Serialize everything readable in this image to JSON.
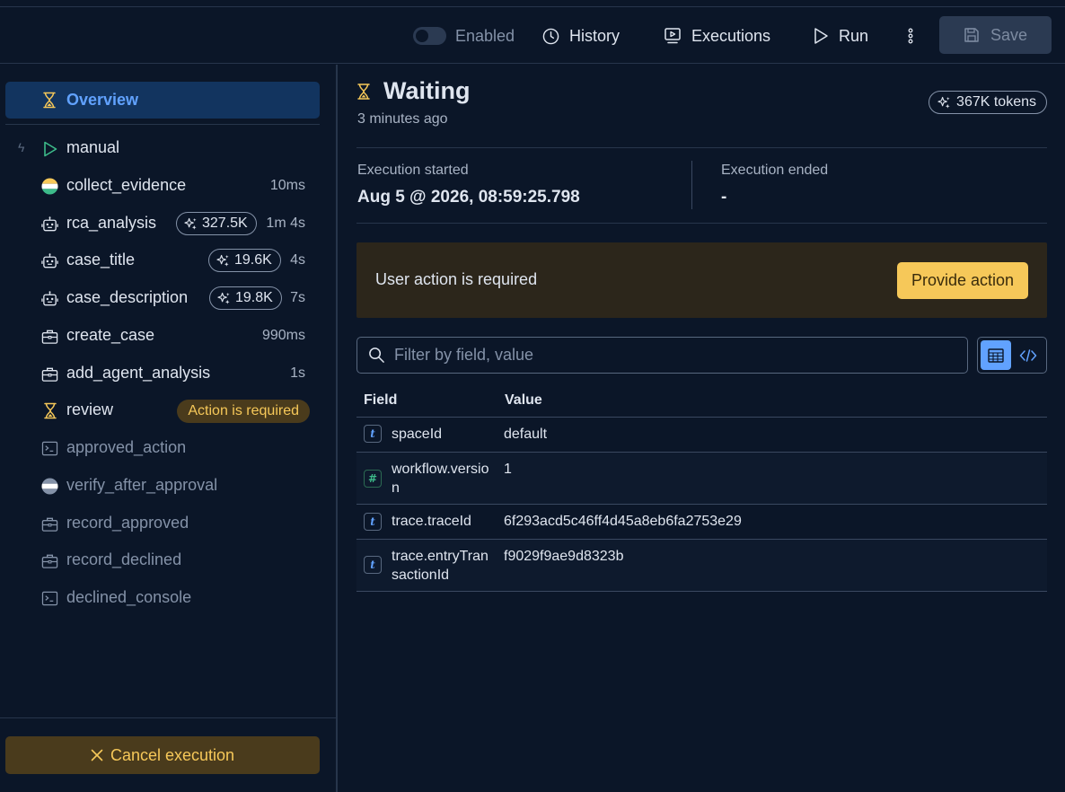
{
  "header": {
    "enabled_label": "Enabled",
    "history_label": "History",
    "executions_label": "Executions",
    "run_label": "Run",
    "save_label": "Save"
  },
  "sidebar": {
    "overview_label": "Overview",
    "steps": [
      {
        "name": "manual",
        "icon": "play-icon"
      },
      {
        "name": "collect_evidence",
        "icon": "elastic-icon",
        "duration": "10ms"
      },
      {
        "name": "rca_analysis",
        "icon": "robot-icon",
        "tokens": "327.5K",
        "duration": "1m 4s"
      },
      {
        "name": "case_title",
        "icon": "robot-icon",
        "tokens": "19.6K",
        "duration": "4s"
      },
      {
        "name": "case_description",
        "icon": "robot-icon",
        "tokens": "19.8K",
        "duration": "7s"
      },
      {
        "name": "create_case",
        "icon": "briefcase-icon",
        "duration": "990ms"
      },
      {
        "name": "add_agent_analysis",
        "icon": "briefcase-icon",
        "duration": "1s"
      },
      {
        "name": "review",
        "icon": "hourglass-icon",
        "badge": "Action is required"
      },
      {
        "name": "approved_action",
        "icon": "console-icon"
      },
      {
        "name": "verify_after_approval",
        "icon": "elastic-icon"
      },
      {
        "name": "record_approved",
        "icon": "briefcase-icon"
      },
      {
        "name": "record_declined",
        "icon": "briefcase-icon"
      },
      {
        "name": "declined_console",
        "icon": "console-icon"
      }
    ],
    "cancel_label": "Cancel execution"
  },
  "main": {
    "status": "Waiting",
    "ago": "3 minutes ago",
    "tokens": "367K tokens",
    "execution_started_label": "Execution started",
    "execution_started_value": "Aug 5 @ 2026, 08:59:25.798",
    "execution_ended_label": "Execution ended",
    "execution_ended_value": "-",
    "callout_text": "User action is required",
    "provide_action_label": "Provide action",
    "filter_placeholder": "Filter by field, value",
    "table": {
      "headers": [
        "Field",
        "Value"
      ],
      "rows": [
        {
          "type": "t",
          "field": "spaceId",
          "value": "default"
        },
        {
          "type": "#",
          "field": "workflow.version",
          "value": "1"
        },
        {
          "type": "t",
          "field": "trace.traceId",
          "value": "6f293acd5c46ff4d45a8eb6fa2753e29"
        },
        {
          "type": "t",
          "field": "trace.entryTransactionId",
          "value": "f9029f9ae9d8323b"
        }
      ]
    }
  },
  "colors": {
    "background": "#0b1628",
    "accent": "#61a2ff",
    "warning": "#f6c859",
    "success": "#3dbb8a"
  }
}
